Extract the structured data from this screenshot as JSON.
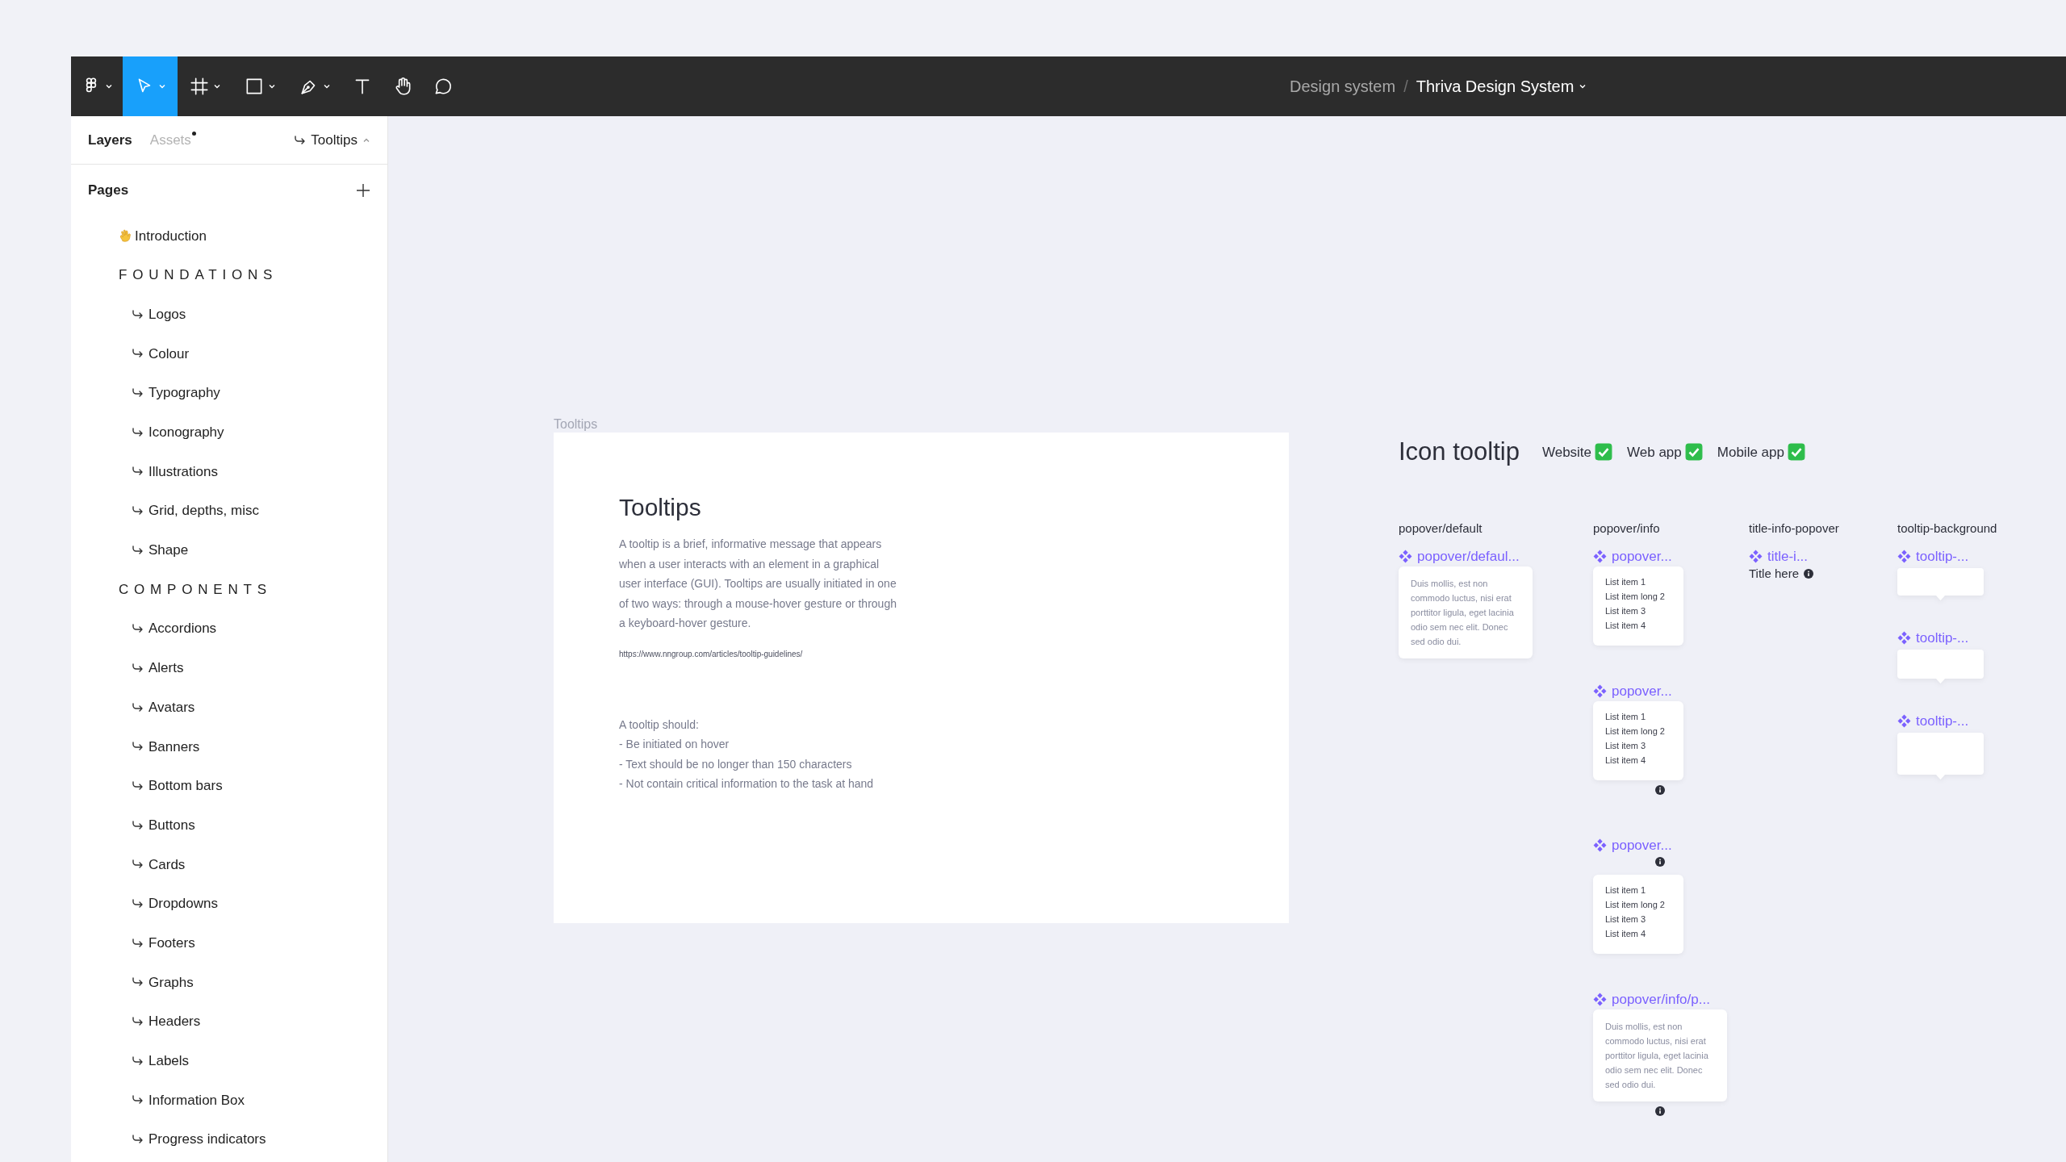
{
  "toolbar": {
    "tools": [
      {
        "kind": "menu",
        "selected": false
      },
      {
        "kind": "move",
        "selected": true
      },
      {
        "kind": "frame",
        "selected": false
      },
      {
        "kind": "shape",
        "selected": false
      },
      {
        "kind": "pen",
        "selected": false
      },
      {
        "kind": "text",
        "selected": false
      },
      {
        "kind": "hand",
        "selected": false
      },
      {
        "kind": "comment",
        "selected": false
      }
    ],
    "breadcrumb": {
      "team": "Design system",
      "separator": "/",
      "file": "Thriva Design System"
    }
  },
  "sidebar": {
    "tabs": [
      {
        "label": "Layers",
        "selected": true,
        "dot": false
      },
      {
        "label": "Assets",
        "selected": false,
        "dot": true
      }
    ],
    "current_page": "Tooltips",
    "pages_heading": "Pages",
    "pages": [
      {
        "kind": "intro",
        "label": "Introduction"
      },
      {
        "kind": "section",
        "label": "FOUNDATIONS"
      },
      {
        "kind": "page",
        "label": "Logos"
      },
      {
        "kind": "page",
        "label": "Colour"
      },
      {
        "kind": "page",
        "label": "Typography"
      },
      {
        "kind": "page",
        "label": "Iconography"
      },
      {
        "kind": "page",
        "label": "Illustrations"
      },
      {
        "kind": "page",
        "label": "Grid, depths, misc"
      },
      {
        "kind": "page",
        "label": "Shape"
      },
      {
        "kind": "section",
        "label": "COMPONENTS"
      },
      {
        "kind": "page",
        "label": "Accordions"
      },
      {
        "kind": "page",
        "label": "Alerts"
      },
      {
        "kind": "page",
        "label": "Avatars"
      },
      {
        "kind": "page",
        "label": "Banners"
      },
      {
        "kind": "page",
        "label": "Bottom bars"
      },
      {
        "kind": "page",
        "label": "Buttons"
      },
      {
        "kind": "page",
        "label": "Cards"
      },
      {
        "kind": "page",
        "label": "Dropdowns"
      },
      {
        "kind": "page",
        "label": "Footers"
      },
      {
        "kind": "page",
        "label": "Graphs"
      },
      {
        "kind": "page",
        "label": "Headers"
      },
      {
        "kind": "page",
        "label": "Labels"
      },
      {
        "kind": "page",
        "label": "Information Box"
      },
      {
        "kind": "page",
        "label": "Progress indicators"
      }
    ]
  },
  "canvas": {
    "frame": {
      "label": "Tooltips",
      "title": "Tooltips",
      "intro": "A tooltip is a brief, informative message that appears when a user interacts with an element in a graphical user interface (GUI). Tooltips are usually initiated in one of two ways: through a mouse-hover gesture or through a keyboard-hover gesture.",
      "link": "https://www.nngroup.com/articles/tooltip-guidelines/",
      "rules_heading": "A tooltip should:",
      "rules": [
        "- Be initiated on hover",
        "- Text should be no longer than 150 characters",
        "- Not contain critical information to the task at hand"
      ]
    },
    "section": {
      "title": "Icon tooltip",
      "platforms": [
        {
          "label": "Website",
          "checked": true
        },
        {
          "label": "Web app",
          "checked": true
        },
        {
          "label": "Mobile app",
          "checked": true
        }
      ]
    },
    "columns": [
      {
        "label": "popover/default",
        "instances": [
          {
            "kind": "text-card",
            "name": "popover/defaul...",
            "text": "Duis mollis, est non commodo luctus, nisi erat porttitor ligula, eget lacinia odio sem nec elit. Donec sed odio dui.",
            "info_above": false,
            "info_below": false
          }
        ]
      },
      {
        "label": "popover/info",
        "instances": [
          {
            "kind": "list-card",
            "name": "popover...",
            "items": [
              "List item 1",
              "List item long 2",
              "List item 3",
              "List item 4"
            ],
            "info_above": false,
            "info_below": false
          },
          {
            "kind": "list-card",
            "name": "popover...",
            "items": [
              "List item 1",
              "List item long 2",
              "List item 3",
              "List item 4"
            ],
            "info_above": false,
            "info_below": true
          },
          {
            "kind": "list-card",
            "name": "popover...",
            "items": [
              "List item 1",
              "List item long 2",
              "List item 3",
              "List item 4"
            ],
            "info_above": true,
            "info_below": false
          },
          {
            "kind": "text-card",
            "name": "popover/info/p...",
            "text": "Duis mollis, est non commodo luctus, nisi erat porttitor ligula, eget lacinia odio sem nec elit. Donec sed odio dui.",
            "info_above": false,
            "info_below": true
          }
        ]
      },
      {
        "label": "title-info-popover",
        "instances": [
          {
            "kind": "title-info",
            "name": "title-i...",
            "title": "Title here",
            "info_above": false,
            "info_below": false
          }
        ]
      },
      {
        "label": "tooltip-background",
        "instances": [
          {
            "kind": "tooltip-bg",
            "name": "tooltip-...",
            "info_above": false,
            "info_below": false
          },
          {
            "kind": "tooltip-bg",
            "name": "tooltip-...",
            "info_above": false,
            "info_below": false
          },
          {
            "kind": "tooltip-bg",
            "name": "tooltip-...",
            "info_above": false,
            "info_below": false
          }
        ]
      }
    ]
  }
}
